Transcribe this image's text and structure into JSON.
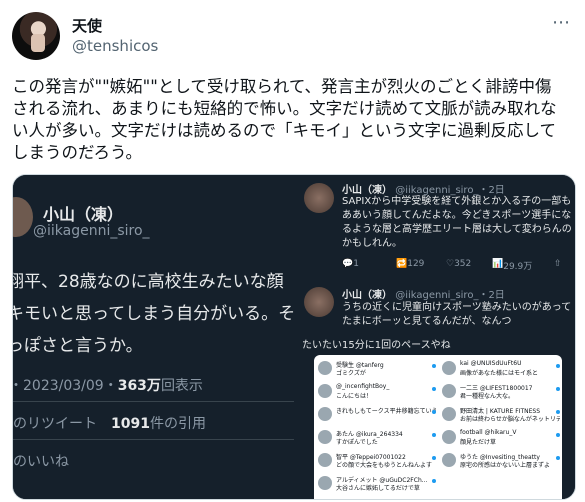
{
  "author": {
    "name": "天使",
    "handle": "@tenshicos"
  },
  "more_icon": "⋯",
  "tweet": {
    "text": "この発言が\"\"嫉妬\"\"として受け取られて、発言主が烈火のごとく誹謗中傷\nされる流れ、あまりにも短絡的で怖い。文字だけ読めて文脈が読み取れな\nい人が多い。文字だけは読めるので「キモイ」という文字に過剰反応して\nしまうのだろう。"
  },
  "media": {
    "left": {
      "name": "小山（凍）",
      "handle": "@iikagenni_siro_",
      "line1": "翔平、28歳なのに高校生みたいな顔",
      "line2": "キモいと思ってしまう自分がいる。そ",
      "line3": "っぽさと言うか。",
      "meta_prefix": "・2023/03/09・",
      "views_count": "363万",
      "views_label": "回表示",
      "retweets_prefix": "のリツイート",
      "quotes_count": "1091",
      "quotes_label": "件の引用",
      "likes_label": "のいいね"
    },
    "right_top": {
      "name": "小山（凍）",
      "handle": "@iikagenni_siro_・2日",
      "body": "SAPIXから中学受験を経て外銀とか入る子の一部もああいう顔してんだよな。今どきスポーツ選手になるような層と高学歴エリート層は大して変わらんのかもしれん。",
      "reply": "1",
      "retweet": "129",
      "like": "352",
      "views": "29.9万",
      "name2": "小山（凍）",
      "handle2": "@iikagenni_siro_・2日",
      "body2": "うちの近くに児童向けスポーツ塾みたいのがあってたまにボーッと見てるんだが、なんつ"
    },
    "right_bottom": {
      "top_text": "たいたい15分に1回のペースやね",
      "col1": [
        {
          "name": "受験生 @tanferg",
          "text": "ゴミクズが"
        },
        {
          "name": "@_incenfightBoy_",
          "text": "こんにちは！"
        },
        {
          "name": "きれもしもてークス平井移籍忘ていうと",
          "text": ""
        },
        {
          "name": "あたん @ikura_264334",
          "text": "すかぽんでした"
        },
        {
          "name": "智平 @Teppei07001022",
          "text": "どの顔で大会をもゆうとんねんよす"
        },
        {
          "name": "アルディメット @uGuDC2FCh...",
          "text": "大谷さんに嫉妬してるだけで草"
        }
      ],
      "col2": [
        {
          "name": "kai @UNUISdUuFt6U",
          "text": "画像があなた様にはモイ系と"
        },
        {
          "name": "一二三 @LIFEST1800017",
          "text": "君一種程なん大な。"
        },
        {
          "name": "野田清太 | KATURE FITNESS",
          "text": "お前は終わらせか脳なんがネットリテラシー無さすぎでも引き続けると"
        },
        {
          "name": "football @hikaru_V",
          "text": "顔見ただけ草"
        },
        {
          "name": "ゆうた @Invesiting_theatty",
          "text": "原宅の所感はかないい上層まずよ"
        }
      ]
    }
  }
}
